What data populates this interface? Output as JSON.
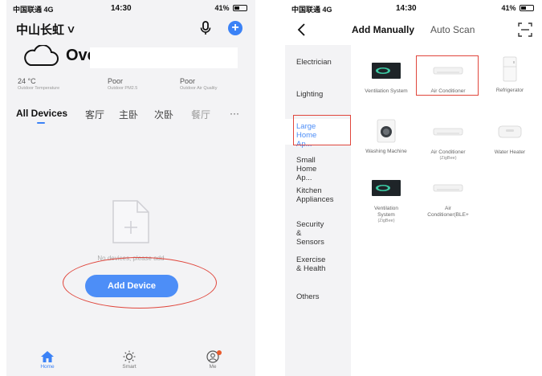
{
  "left_phone": {
    "status": {
      "carrier": "中国联通 4G",
      "time": "14:30",
      "battery": "41%"
    },
    "home_name": "中山长虹 ˅",
    "weather": {
      "condition": "Overcast"
    },
    "metrics": [
      {
        "value": "24 °C",
        "label": "Outdoor Temperature"
      },
      {
        "value": "Poor",
        "label": "Outdoor PM2.5"
      },
      {
        "value": "Poor",
        "label": "Outdoor Air Quality"
      }
    ],
    "tabs": [
      "All Devices",
      "客厅",
      "主卧",
      "次卧",
      "餐厅",
      "···"
    ],
    "empty_text": "No devices, please add",
    "add_button": "Add Device",
    "nav": [
      {
        "label": "Home",
        "icon": "home-icon"
      },
      {
        "label": "Smart",
        "icon": "sun-icon"
      },
      {
        "label": "Me",
        "icon": "person-icon"
      }
    ],
    "colors": {
      "accent": "#3b82f6",
      "highlight": "#e0463c"
    }
  },
  "right_phone": {
    "status": {
      "carrier": "中国联通 4G",
      "time": "14:30",
      "battery": "41%"
    },
    "tabs": {
      "manual": "Add Manually",
      "auto": "Auto Scan"
    },
    "categories": [
      "Electrician",
      "Lighting",
      "Large Home Ap...",
      "Small Home Ap...",
      "Kitchen Appliances",
      "Security & Sensors",
      "Exercise & Health",
      "Others"
    ],
    "devices": [
      {
        "name": "Ventilation System",
        "sub": "",
        "icon": "ventilation-icon"
      },
      {
        "name": "Air Conditioner",
        "sub": "",
        "icon": "air-conditioner-icon"
      },
      {
        "name": "Refrigerator",
        "sub": "",
        "icon": "refrigerator-icon"
      },
      {
        "name": "Washing Machine",
        "sub": "",
        "icon": "washing-machine-icon"
      },
      {
        "name": "Air Conditioner",
        "sub": "(ZigBee)",
        "icon": "air-conditioner-icon"
      },
      {
        "name": "Water Heater",
        "sub": "",
        "icon": "water-heater-icon"
      },
      {
        "name": "Ventilation System",
        "sub": "(ZigBee)",
        "icon": "ventilation-icon"
      },
      {
        "name": "Air Conditioner(BLE+",
        "sub": "",
        "icon": "air-conditioner-icon"
      }
    ]
  }
}
